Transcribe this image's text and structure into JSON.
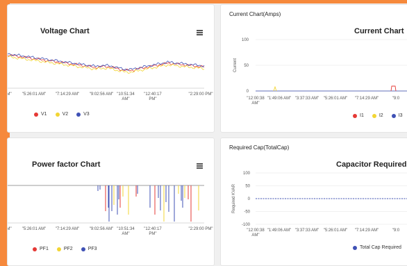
{
  "voltage": {
    "title": "Voltage Chart",
    "icon": "menu-icon",
    "x_ticks": [
      {
        "l1": "AM\"",
        "l2": ""
      },
      {
        "l1": "\"5:26:01 AM\"",
        "l2": ""
      },
      {
        "l1": "\"7:14:29 AM\"",
        "l2": ""
      },
      {
        "l1": "\"9:02:56 AM\"",
        "l2": ""
      },
      {
        "l1": "\"10:51:34",
        "l2": "AM\""
      },
      {
        "l1": "\"12:40:17",
        "l2": "PM\""
      },
      {
        "l1": "\"2:29:00 PM\"",
        "l2": ""
      }
    ],
    "legend": [
      {
        "label": "V1",
        "color": "#e53935"
      },
      {
        "label": "V2",
        "color": "#f2d533"
      },
      {
        "label": "V3",
        "color": "#3f51b5"
      }
    ]
  },
  "current": {
    "heading": "Current Chart(Amps)",
    "title": "Current Chart",
    "ylabel": "Current",
    "y_ticks": [
      "100",
      "50",
      "0"
    ],
    "x_ticks": [
      {
        "l1": "\"12:00:38",
        "l2": "AM\""
      },
      {
        "l1": "\"1:49:06 AM\"",
        "l2": ""
      },
      {
        "l1": "\"3:37:33 AM\"",
        "l2": ""
      },
      {
        "l1": "\"5:26:01 AM\"",
        "l2": ""
      },
      {
        "l1": "\"7:14:29 AM\"",
        "l2": ""
      },
      {
        "l1": "\"9:0",
        "l2": ""
      }
    ],
    "legend": [
      {
        "label": "I1",
        "color": "#e53935"
      },
      {
        "label": "I2",
        "color": "#f2d533"
      },
      {
        "label": "I3",
        "color": "#3f51b5"
      }
    ]
  },
  "pf": {
    "title": "Power factor Chart",
    "icon": "menu-icon",
    "x_ticks": [
      {
        "l1": "AM\"",
        "l2": ""
      },
      {
        "l1": "\"5:26:01 AM\"",
        "l2": ""
      },
      {
        "l1": "\"7:14:29 AM\"",
        "l2": ""
      },
      {
        "l1": "\"9:02:56 AM\"",
        "l2": ""
      },
      {
        "l1": "\"10:51:34",
        "l2": "AM\""
      },
      {
        "l1": "\"12:40:17",
        "l2": "PM\""
      },
      {
        "l1": "\"2:29:00 PM\"",
        "l2": ""
      }
    ],
    "legend": [
      {
        "label": "PF1",
        "color": "#e53935"
      },
      {
        "label": "PF2",
        "color": "#f2d533"
      },
      {
        "label": "PF3",
        "color": "#3f51b5"
      }
    ]
  },
  "cap": {
    "heading": "Required Cap(TotalCap)",
    "title": "Capacitor Required Ch",
    "ylabel": "Required KVAR",
    "y_ticks": [
      "100",
      "50",
      "0",
      "-50",
      "-100"
    ],
    "x_ticks": [
      {
        "l1": "\"12:00:38",
        "l2": "AM\""
      },
      {
        "l1": "\"1:49:06 AM\"",
        "l2": ""
      },
      {
        "l1": "\"3:37:33 AM\"",
        "l2": ""
      },
      {
        "l1": "\"5:26:01 AM\"",
        "l2": ""
      },
      {
        "l1": "\"7:14:29 AM\"",
        "l2": ""
      },
      {
        "l1": "\"9:0",
        "l2": ""
      }
    ],
    "legend": [
      {
        "label": "Total Cap Required",
        "color": "#3f51b5"
      }
    ]
  },
  "chart_data": [
    {
      "type": "line",
      "title": "Voltage Chart",
      "xlabel": "",
      "ylabel": "",
      "categories": [
        "5:26:01 AM",
        "7:14:29 AM",
        "9:02:56 AM",
        "10:51:34 AM",
        "12:40:17 PM",
        "2:29:00 PM"
      ],
      "grid": true,
      "legend": "bottom-left",
      "series": [
        {
          "name": "V1",
          "color": "#e53935"
        },
        {
          "name": "V2",
          "color": "#f2d533"
        },
        {
          "name": "V3",
          "color": "#3f51b5"
        }
      ]
    },
    {
      "type": "line",
      "title": "Current Chart",
      "ylabel": "Current",
      "ylim": [
        0,
        100
      ],
      "categories": [
        "12:00:38 AM",
        "1:49:06 AM",
        "3:37:33 AM",
        "5:26:01 AM",
        "7:14:29 AM"
      ],
      "grid": true,
      "legend": "bottom-right",
      "series": [
        {
          "name": "I1",
          "color": "#e53935"
        },
        {
          "name": "I2",
          "color": "#f2d533"
        },
        {
          "name": "I3",
          "color": "#3f51b5"
        }
      ]
    },
    {
      "type": "line",
      "title": "Power factor Chart",
      "categories": [
        "5:26:01 AM",
        "7:14:29 AM",
        "9:02:56 AM",
        "10:51:34 AM",
        "12:40:17 PM",
        "2:29:00 PM"
      ],
      "grid": true,
      "legend": "bottom-left",
      "series": [
        {
          "name": "PF1",
          "color": "#e53935"
        },
        {
          "name": "PF2",
          "color": "#f2d533"
        },
        {
          "name": "PF3",
          "color": "#3f51b5"
        }
      ]
    },
    {
      "type": "line",
      "title": "Capacitor Required Ch",
      "ylabel": "Required KVAR",
      "ylim": [
        -100,
        100
      ],
      "categories": [
        "12:00:38 AM",
        "1:49:06 AM",
        "3:37:33 AM",
        "5:26:01 AM",
        "7:14:29 AM"
      ],
      "grid": true,
      "legend": "bottom",
      "series": [
        {
          "name": "Total Cap Required",
          "color": "#3f51b5",
          "values": [
            0,
            0,
            0,
            0,
            0
          ]
        }
      ]
    }
  ]
}
